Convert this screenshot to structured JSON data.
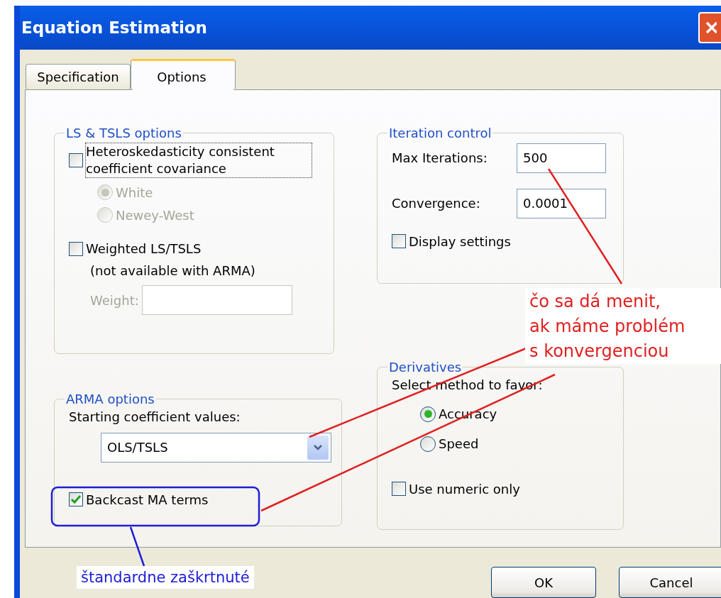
{
  "window": {
    "title": "Equation Estimation"
  },
  "tabs": [
    {
      "label": "Specification",
      "selected": false
    },
    {
      "label": "Options",
      "selected": true
    }
  ],
  "groups": [
    {
      "title": "LS & TSLS options",
      "items": [
        {
          "kind": "checkbox",
          "label": "Heteroskedasticity consistent coefficient covariance",
          "checked": false,
          "disabled": false,
          "focused": true
        },
        {
          "kind": "radio",
          "label": "White",
          "selected": true,
          "disabled": true
        },
        {
          "kind": "radio",
          "label": "Newey-West",
          "selected": false,
          "disabled": true
        },
        {
          "kind": "checkbox",
          "label": "Weighted LS/TSLS",
          "checked": false,
          "disabled": false,
          "focused": false
        },
        {
          "kind": "note",
          "label": "(not available with ARMA)",
          "disabled": false
        },
        {
          "kind": "subfield",
          "label": "Weight:",
          "disabled": true
        }
      ]
    },
    {
      "title": "ARMA options",
      "items": [
        {
          "kind": "label",
          "label": "Starting coefficient values:",
          "disabled": false
        },
        {
          "kind": "dropdown",
          "value": "OLS/TSLS",
          "disabled": false
        },
        {
          "kind": "checkbox",
          "label": "Backcast MA terms",
          "checked": true,
          "disabled": false,
          "focused": false
        }
      ]
    },
    {
      "title": "Iteration control",
      "items": [
        {
          "kind": "field",
          "label": "Max Iterations:",
          "value": "500",
          "disabled": false
        },
        {
          "kind": "field",
          "label": "Convergence:",
          "value": "0.0001",
          "disabled": false
        },
        {
          "kind": "checkbox",
          "label": "Display settings",
          "checked": false,
          "disabled": false,
          "focused": false
        }
      ]
    },
    {
      "title": "Derivatives",
      "items": [
        {
          "kind": "label",
          "label": "Select method to favor:",
          "disabled": false
        },
        {
          "kind": "radio",
          "label": "Accuracy",
          "selected": true,
          "disabled": false
        },
        {
          "kind": "radio",
          "label": "Speed",
          "selected": false,
          "disabled": false
        },
        {
          "kind": "checkbox",
          "label": "Use numeric only",
          "checked": false,
          "disabled": false,
          "focused": false
        }
      ]
    }
  ],
  "buttons": [
    "OK",
    "Cancel"
  ],
  "annotations": {
    "red_note": [
      "čo sa dá menit,",
      "ak máme problém",
      "s konvergenciou"
    ],
    "blue_note": "štandardne zaškrtnuté"
  }
}
